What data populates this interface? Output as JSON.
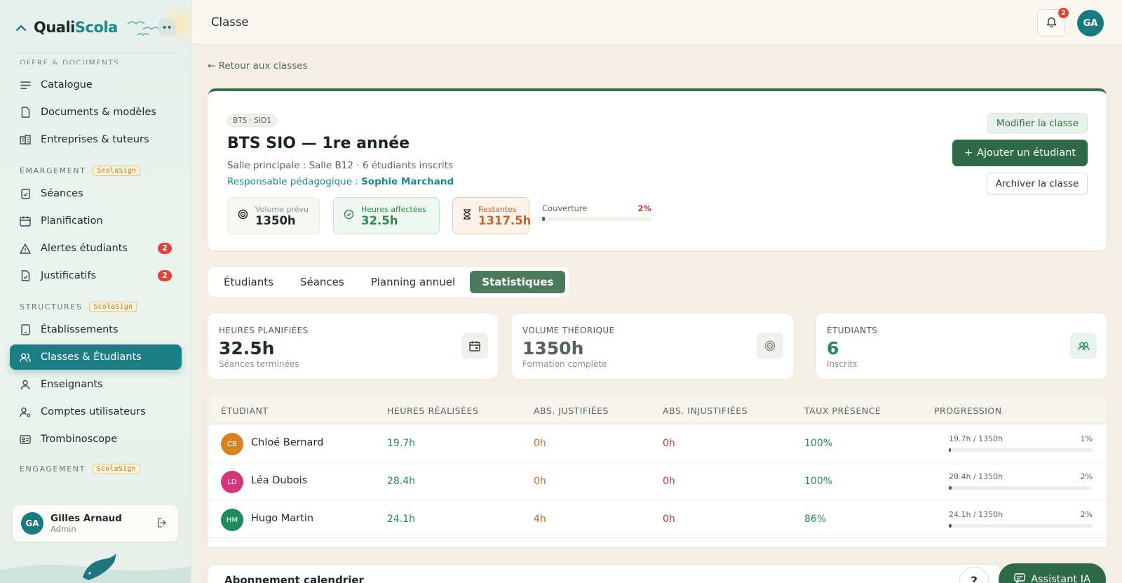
{
  "brand": {
    "name_prefix": "Quali",
    "name_accent": "Scola",
    "toggle_label": "••"
  },
  "sidebar": {
    "cut_section": "OFFRE & DOCUMENTS",
    "items_offre": [
      {
        "label": "Catalogue",
        "icon": "list-icon"
      },
      {
        "label": "Documents & modèles",
        "icon": "file-icon"
      },
      {
        "label": "Entreprises & tuteurs",
        "icon": "building-icon"
      }
    ],
    "emargement": {
      "label": "ÉMARGEMENT",
      "pill": "ScolaSign",
      "items": [
        {
          "label": "Séances",
          "icon": "clipboard-icon"
        },
        {
          "label": "Planification",
          "icon": "calendar-icon"
        },
        {
          "label": "Alertes étudiants",
          "icon": "alert-icon",
          "badge": "2"
        },
        {
          "label": "Justificatifs",
          "icon": "document-check-icon",
          "badge": "2"
        }
      ]
    },
    "structures": {
      "label": "STRUCTURES",
      "pill": "ScolaSign",
      "items": [
        {
          "label": "Établissements",
          "icon": "tablet-icon"
        },
        {
          "label": "Classes & Étudiants",
          "icon": "users-icon",
          "active": true
        },
        {
          "label": "Enseignants",
          "icon": "user-icon"
        },
        {
          "label": "Comptes utilisateurs",
          "icon": "user-cog-icon"
        },
        {
          "label": "Trombinoscope",
          "icon": "id-card-icon"
        }
      ]
    },
    "engagement": {
      "label": "ENGAGEMENT",
      "pill": "ScolaSign"
    },
    "user": {
      "initials": "GA",
      "name": "Gilles Arnaud",
      "role": "Admin"
    }
  },
  "topbar": {
    "title": "Classe",
    "notifications": "2",
    "avatar": "GA"
  },
  "back_link": "← Retour aux classes",
  "class": {
    "tag": "BTS · SIO1",
    "title": "BTS SIO — 1re année",
    "subtitle": "Salle principale : Salle B12 · 6 étudiants inscrits",
    "resp_label": "Responsable pédagogique : ",
    "resp_name": "Sophie Marchand",
    "volume_label": "Volume prévu",
    "volume_value": "1350h",
    "affected_label": "Heures affectées",
    "affected_value": "32.5h",
    "remaining_label": "Restantes",
    "remaining_value": "1317.5h",
    "coverage_label": "Couverture",
    "coverage_value": "2%",
    "coverage_fraction": 0.024,
    "btn_modify": "Modifier la classe",
    "btn_add": "Ajouter un étudiant",
    "btn_archive": "Archiver la classe"
  },
  "tabs": [
    {
      "label": "Étudiants"
    },
    {
      "label": "Séances"
    },
    {
      "label": "Planning annuel"
    },
    {
      "label": "Statistiques",
      "active": true
    }
  ],
  "stats": [
    {
      "label": "HEURES PLANIFIÉES",
      "value": "32.5h",
      "sub": "Séances terminées",
      "icon": "calendar-icon",
      "color": "#1f2a2a",
      "icon_bg": "#f1f0ea"
    },
    {
      "label": "VOLUME THÉORIQUE",
      "value": "1350h",
      "sub": "Formation complète",
      "icon": "target-icon",
      "color": "#55615e",
      "icon_bg": "#f1f0ea"
    },
    {
      "label": "ÉTUDIANTS",
      "value": "6",
      "sub": "Inscrits",
      "icon": "users-icon",
      "color": "#2a8a5e",
      "icon_bg": "#e6f4ec"
    }
  ],
  "table": {
    "headers": [
      "ÉTUDIANT",
      "HEURES RÉALISÉES",
      "ABS. JUSTIFIÉES",
      "ABS. INJUSTIFIÉES",
      "TAUX PRÉSENCE",
      "PROGRESSION"
    ],
    "rows": [
      {
        "initials": "CB",
        "avatar_color": "#d9821f",
        "name": "Chloé Bernard",
        "hours": "19.7h",
        "abs_j": "0h",
        "abs_i": "0h",
        "presence": "100%",
        "prog_label": "19.7h / 1350h",
        "prog_pct": "1%",
        "prog_fraction": 0.015
      },
      {
        "initials": "LD",
        "avatar_color": "#d4367a",
        "name": "Léa Dubois",
        "hours": "28.4h",
        "abs_j": "0h",
        "abs_i": "0h",
        "presence": "100%",
        "prog_label": "28.4h / 1350h",
        "prog_pct": "2%",
        "prog_fraction": 0.021
      },
      {
        "initials": "HM",
        "avatar_color": "#1f8a5e",
        "name": "Hugo Martin",
        "hours": "24.1h",
        "abs_j": "4h",
        "abs_i": "0h",
        "presence": "86%",
        "prog_label": "24.1h / 1350h",
        "prog_pct": "2%",
        "prog_fraction": 0.018
      }
    ]
  },
  "calendar_card": "Abonnement calendrier",
  "help_label": "?",
  "ai_button": "Assistant IA"
}
